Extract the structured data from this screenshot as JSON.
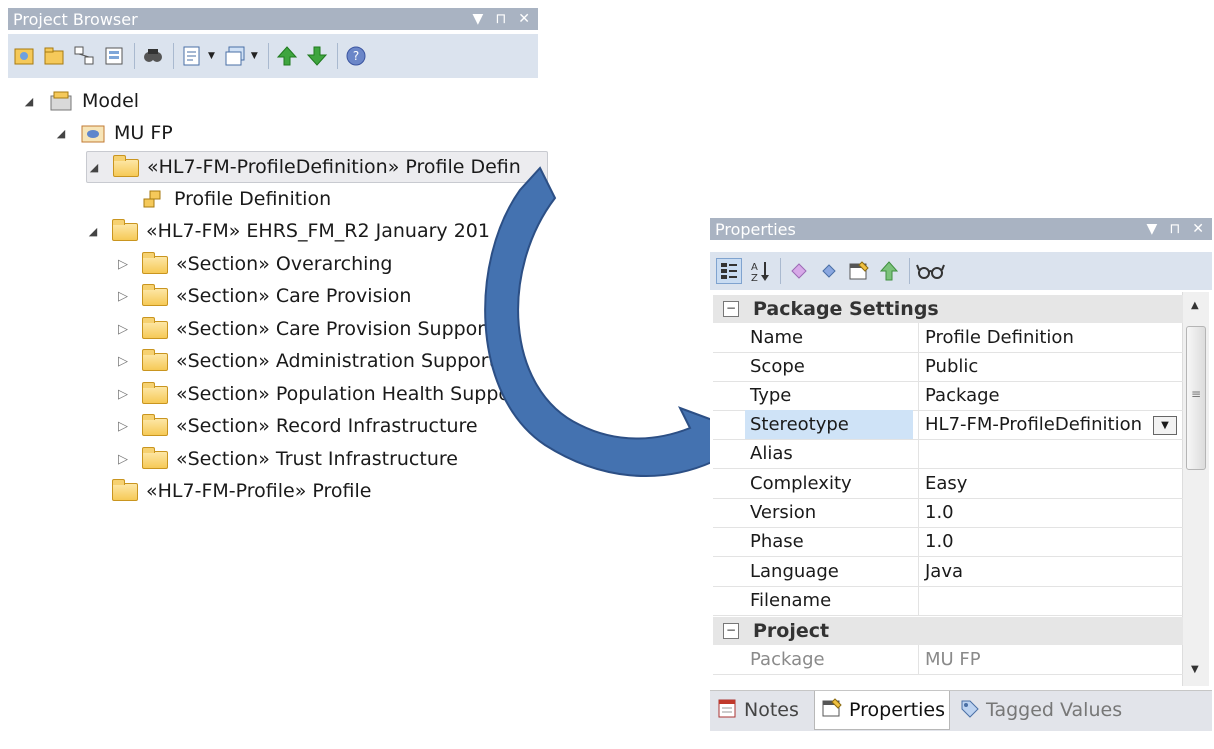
{
  "project_browser": {
    "title": "Project Browser",
    "controls": [
      "▼",
      "⊓",
      "✕"
    ],
    "tree": [
      {
        "label": "Model",
        "expanded": true
      },
      {
        "label": "MU FP",
        "expanded": true
      },
      {
        "label": "«HL7-FM-ProfileDefinition» Profile Defin",
        "expanded": true,
        "selected": true
      },
      {
        "label": "Profile Definition"
      },
      {
        "label": "«HL7-FM» EHRS_FM_R2 January 201",
        "expanded": true
      },
      {
        "label": "«Section» Overarching",
        "expanded": false
      },
      {
        "label": "«Section» Care Provision",
        "expanded": false
      },
      {
        "label": "«Section» Care Provision Suppor",
        "expanded": false
      },
      {
        "label": "«Section» Administration Support",
        "expanded": false
      },
      {
        "label": "«Section» Population Health Suppor",
        "expanded": false
      },
      {
        "label": "«Section» Record Infrastructure",
        "expanded": false
      },
      {
        "label": "«Section» Trust Infrastructure",
        "expanded": false
      },
      {
        "label": "«HL7-FM-Profile» Profile"
      }
    ]
  },
  "properties": {
    "title": "Properties",
    "controls": [
      "▼",
      "⊓",
      "✕"
    ],
    "categories": {
      "package_settings": "Package Settings",
      "project": "Project"
    },
    "rows": [
      {
        "name": "Name",
        "value": "Profile Definition"
      },
      {
        "name": "Scope",
        "value": "Public"
      },
      {
        "name": "Type",
        "value": "Package"
      },
      {
        "name": "Stereotype",
        "value": "HL7-FM-ProfileDefinition"
      },
      {
        "name": "Alias",
        "value": ""
      },
      {
        "name": "Complexity",
        "value": "Easy"
      },
      {
        "name": "Version",
        "value": "1.0"
      },
      {
        "name": "Phase",
        "value": "1.0"
      },
      {
        "name": "Language",
        "value": "Java"
      },
      {
        "name": "Filename",
        "value": ""
      }
    ],
    "project_rows": [
      {
        "name": "Package",
        "value": "MU FP"
      }
    ],
    "tabs": {
      "notes": "Notes",
      "properties": "Properties",
      "tagged_values": "Tagged Values"
    }
  },
  "colors": {
    "titlebar": "#a9b3c2",
    "toolbar": "#dbe3ee",
    "arrow": "#4472b0",
    "selected_cell": "#cfe3f7"
  }
}
